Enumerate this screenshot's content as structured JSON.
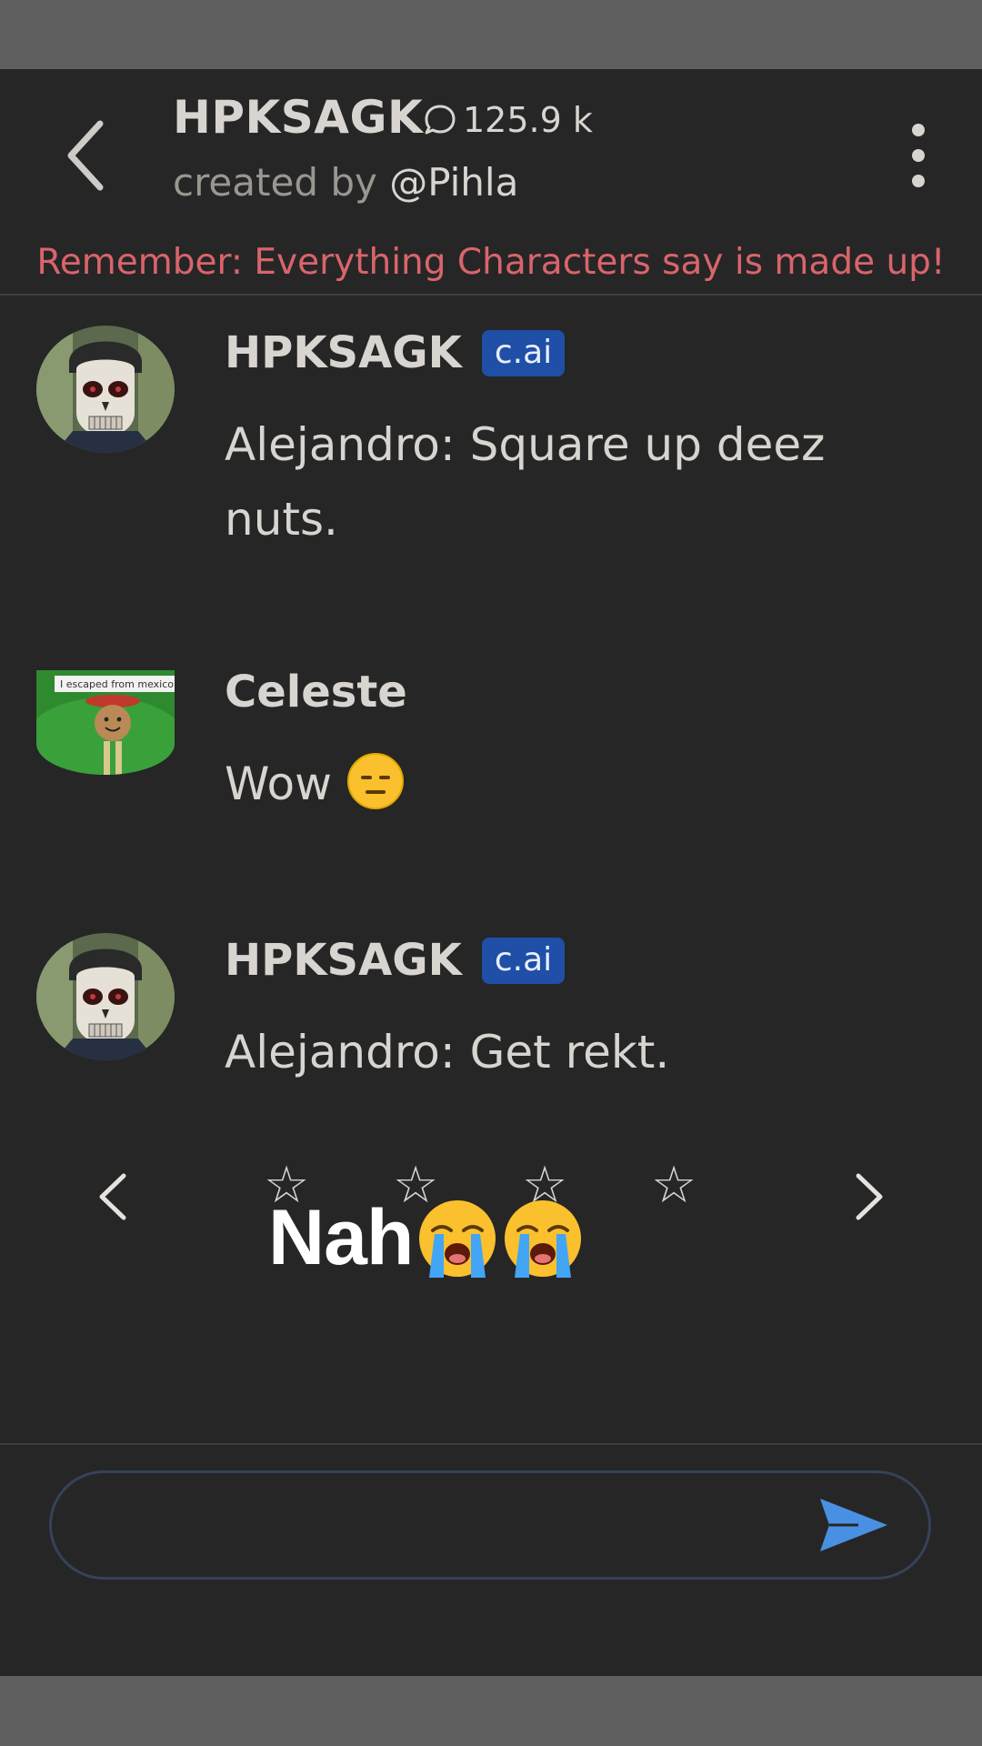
{
  "header": {
    "title": "HPKSAGK",
    "chat_count": "125.9 k",
    "created_by_prefix": "created by",
    "created_by_handle": "@Pihla",
    "disclaimer": "Remember: Everything Characters say is made up!"
  },
  "messages": [
    {
      "author": "HPKSAGK",
      "badge": "c.ai",
      "text": "Alejandro: Square up deez nuts."
    },
    {
      "author": "Celeste",
      "avatar_caption": "I escaped from mexico",
      "text": "Wow"
    },
    {
      "author": "HPKSAGK",
      "badge": "c.ai",
      "text": "Alejandro: Get rekt."
    }
  ],
  "rating": {
    "stars": [
      "☆",
      "☆",
      "☆",
      "☆"
    ],
    "filled": 0
  },
  "overlay_caption": "Nah",
  "composer": {
    "value": "",
    "placeholder": ""
  },
  "colors": {
    "background": "#262626",
    "disclaimer": "#d9646c",
    "badge": "#1f4fa6",
    "send": "#4a90e2",
    "text": "#d8d4cf"
  }
}
